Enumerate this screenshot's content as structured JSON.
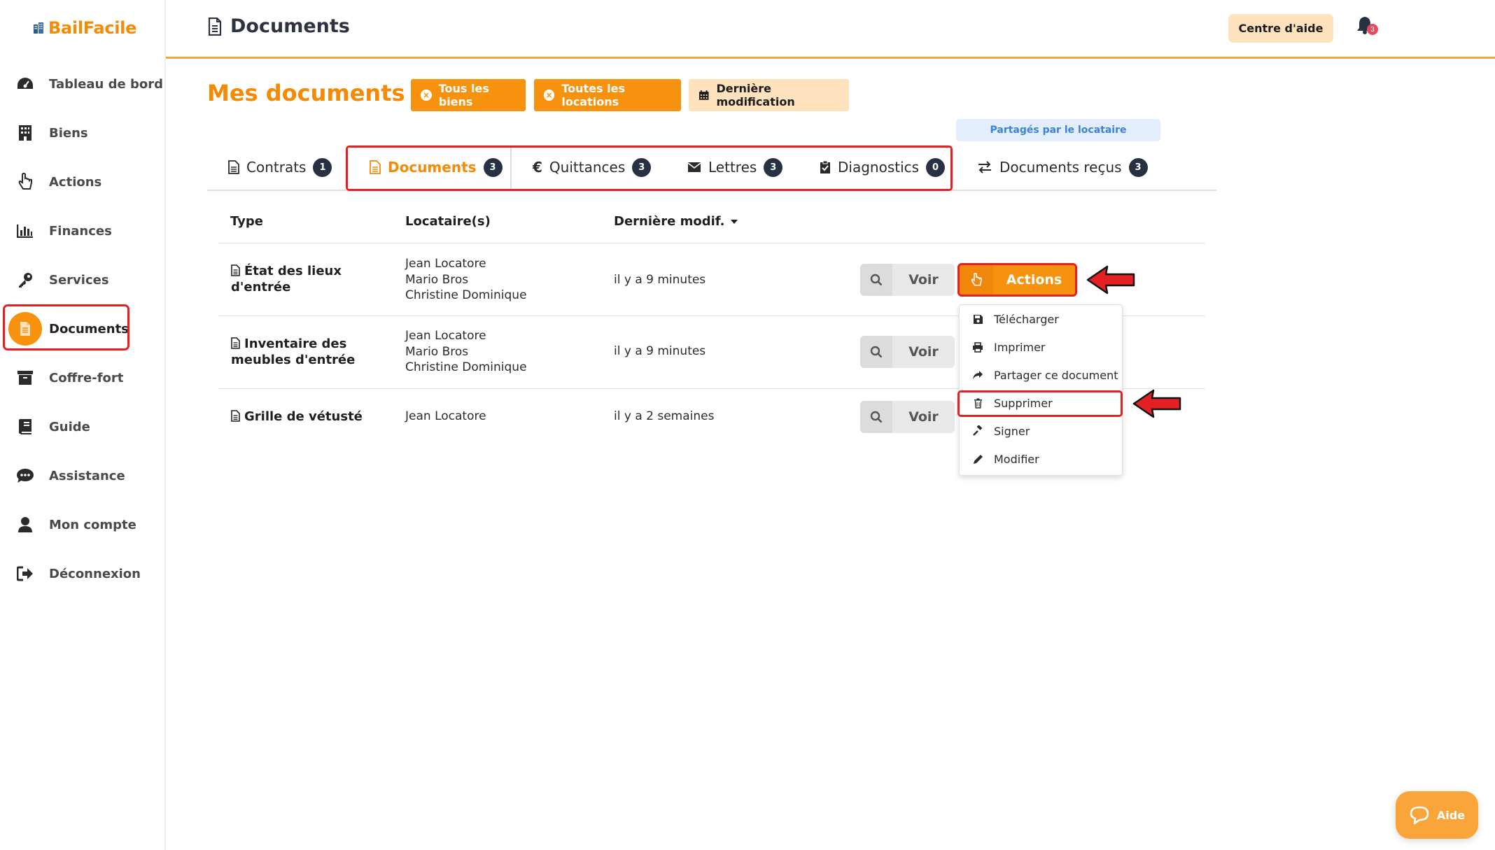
{
  "app": {
    "name": "BailFacile"
  },
  "header": {
    "title": "Documents",
    "help_label": "Centre d'aide",
    "notif_count": "3"
  },
  "sidebar": {
    "items": [
      {
        "label": "Tableau de bord",
        "icon": "dashboard-icon"
      },
      {
        "label": "Biens",
        "icon": "building-icon"
      },
      {
        "label": "Actions",
        "icon": "hand-pointer-icon"
      },
      {
        "label": "Finances",
        "icon": "bar-chart-icon"
      },
      {
        "label": "Services",
        "icon": "key-icon"
      },
      {
        "label": "Documents",
        "icon": "document-icon",
        "active": true
      },
      {
        "label": "Coffre-fort",
        "icon": "archive-icon"
      },
      {
        "label": "Guide",
        "icon": "book-icon"
      },
      {
        "label": "Assistance",
        "icon": "chat-icon"
      },
      {
        "label": "Mon compte",
        "icon": "user-icon"
      },
      {
        "label": "Déconnexion",
        "icon": "sign-out-icon"
      }
    ]
  },
  "section": {
    "title": "Mes documents",
    "filters": [
      {
        "label": "Tous les biens",
        "style": "orange"
      },
      {
        "label": "Toutes les locations",
        "style": "orange"
      },
      {
        "label": "Dernière modification",
        "style": "light"
      }
    ],
    "shared_badge": "Partagés par le locataire"
  },
  "tabs": [
    {
      "label": "Contrats",
      "count": "1"
    },
    {
      "label": "Documents",
      "count": "3",
      "active": true
    },
    {
      "label": "Quittances",
      "count": "3"
    },
    {
      "label": "Lettres",
      "count": "3"
    },
    {
      "label": "Diagnostics",
      "count": "0"
    },
    {
      "label": "Documents reçus",
      "count": "3"
    }
  ],
  "table": {
    "headers": {
      "type": "Type",
      "tenants": "Locataire(s)",
      "date": "Dernière modif."
    },
    "rows": [
      {
        "type_l1": "État des lieux",
        "type_l2": "d'entrée",
        "tenants": [
          "Jean Locatore",
          "Mario Bros",
          "Christine Dominique"
        ],
        "date": "il y a 9 minutes"
      },
      {
        "type_l1": "Inventaire des",
        "type_l2": "meubles d'entrée",
        "tenants": [
          "Jean Locatore",
          "Mario Bros",
          "Christine Dominique"
        ],
        "date": "il y a 9 minutes"
      },
      {
        "type_l1": "Grille de vétusté",
        "type_l2": "",
        "tenants": [
          "Jean Locatore",
          "",
          ""
        ],
        "date": "il y a 2 semaines"
      }
    ],
    "view_label": "Voir",
    "actions_label": "Actions"
  },
  "dropdown": {
    "items": [
      {
        "label": "Télécharger",
        "icon": "save-icon"
      },
      {
        "label": "Imprimer",
        "icon": "print-icon"
      },
      {
        "label": "Partager ce document",
        "icon": "share-icon"
      },
      {
        "label": "Supprimer",
        "icon": "trash-icon"
      },
      {
        "label": "Signer",
        "icon": "gavel-icon"
      },
      {
        "label": "Modifier",
        "icon": "pencil-icon"
      }
    ]
  },
  "help_widget": {
    "label": "Aide"
  },
  "colors": {
    "accent": "#f7920e",
    "brand": "#f58a07",
    "highlight": "#e32124",
    "badge": "#283142"
  }
}
